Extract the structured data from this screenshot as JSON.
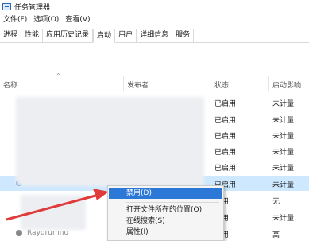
{
  "window": {
    "title": "任务管理器"
  },
  "menu": [
    "文件(F)",
    "选项(O)",
    "查看(V)"
  ],
  "tabs": [
    "进程",
    "性能",
    "应用历史记录",
    "启动",
    "用户",
    "详细信息",
    "服务"
  ],
  "active_tab": "启动",
  "table": {
    "columns": {
      "name": "名称",
      "publisher": "发布者",
      "status": "状态",
      "impact": "启动影响"
    },
    "rows": [
      {
        "status": "已启用",
        "impact": "未计量"
      },
      {
        "status": "已启用",
        "impact": "未计量"
      },
      {
        "status": "已启用",
        "impact": "未计量"
      },
      {
        "status": "已启用",
        "impact": "未计量"
      },
      {
        "status": "已启用",
        "impact": "未计量"
      },
      {
        "status": "已启用",
        "impact": "未计量"
      },
      {
        "status": "启用",
        "impact": "无"
      },
      {
        "status": "启用",
        "impact": "未计量"
      },
      {
        "status": "启用",
        "impact": "高"
      }
    ],
    "partial_row_name": "Raydrumno"
  },
  "context_menu": {
    "items": [
      "禁用(D)",
      "打开文件所在的位置(O)",
      "在线搜索(S)",
      "属性(I)"
    ],
    "highlighted": "禁用(D)"
  },
  "colors": {
    "highlight_row": "#cde8ff",
    "menu_hover": "#2b78d6",
    "annotation_arrow": "#e03a3a"
  }
}
